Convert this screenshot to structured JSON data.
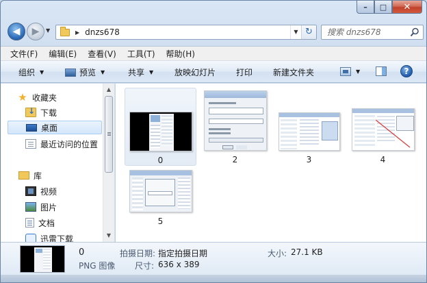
{
  "window": {
    "caption": {
      "minimize": "–",
      "maximize": "□",
      "close": "✕"
    }
  },
  "address": {
    "path": "dnzs678",
    "nav_back": "◀",
    "nav_forward": "▶",
    "refresh": "↻"
  },
  "search": {
    "placeholder": "搜索 dnzs678"
  },
  "menubar": [
    "文件(F)",
    "编辑(E)",
    "查看(V)",
    "工具(T)",
    "帮助(H)"
  ],
  "toolbar": {
    "organize": "组织",
    "preview": "预览",
    "share": "共享",
    "slideshow": "放映幻灯片",
    "print": "打印",
    "new_folder": "新建文件夹",
    "help": "?"
  },
  "navpane": {
    "favorites": "收藏夹",
    "downloads": "下载",
    "desktop": "桌面",
    "recent": "最近访问的位置",
    "libraries": "库",
    "videos": "视频",
    "pictures": "图片",
    "documents": "文档",
    "thunder": "迅雷下载"
  },
  "files": [
    {
      "name": "0"
    },
    {
      "name": "2"
    },
    {
      "name": "3"
    },
    {
      "name": "4"
    },
    {
      "name": "5"
    }
  ],
  "details": {
    "name": "0",
    "type": "PNG 图像",
    "date_label": "拍摄日期:",
    "date_value": "指定拍摄日期",
    "size_label": "大小:",
    "size_value": "27.1 KB",
    "dims_label": "尺寸:",
    "dims_value": "636 x 389"
  },
  "colors": {
    "selection": "#d4e6fb",
    "accent": "#2c6bb7",
    "close_button": "#c1412b"
  }
}
